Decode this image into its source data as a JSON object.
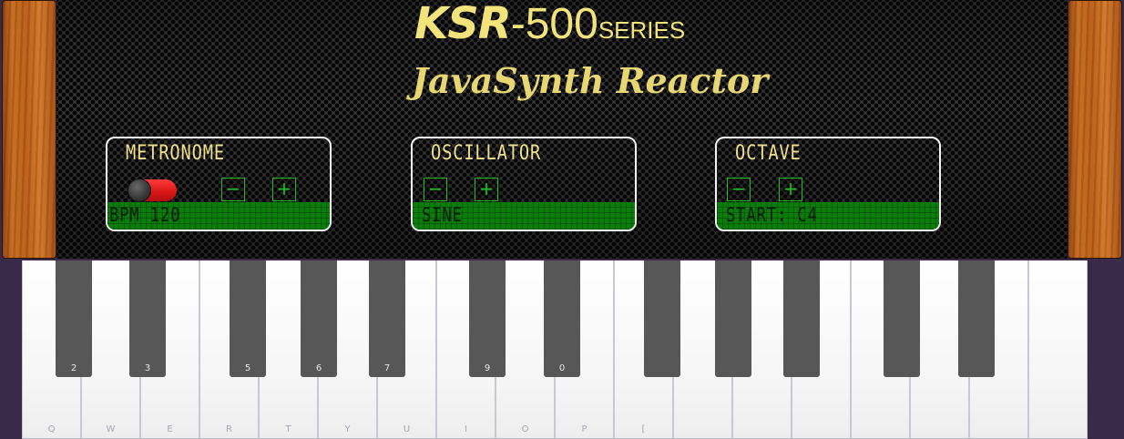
{
  "header": {
    "brand": "KSR",
    "dash": "-",
    "model": "500",
    "series": "SERIES",
    "subtitle": "JavaSynth Reactor"
  },
  "metronome": {
    "title": "METRONOME",
    "toggle_on": false,
    "minus_label": "−",
    "plus_label": "+",
    "display": "BPM 120"
  },
  "oscillator": {
    "title": "OSCILLATOR",
    "minus_label": "−",
    "plus_label": "+",
    "display": "SINE"
  },
  "octave": {
    "title": "OCTAVE",
    "minus_label": "−",
    "plus_label": "+",
    "display": "START: C4"
  },
  "keyboard": {
    "white_keys": [
      {
        "label": "Q"
      },
      {
        "label": "W"
      },
      {
        "label": "E"
      },
      {
        "label": "R"
      },
      {
        "label": "T"
      },
      {
        "label": "Y"
      },
      {
        "label": "U"
      },
      {
        "label": "I"
      },
      {
        "label": "O"
      },
      {
        "label": "P"
      },
      {
        "label": "["
      },
      {
        "label": ""
      },
      {
        "label": ""
      },
      {
        "label": ""
      },
      {
        "label": ""
      },
      {
        "label": ""
      },
      {
        "label": ""
      },
      {
        "label": ""
      }
    ],
    "black_keys": [
      {
        "label": "2"
      },
      {
        "label": "3"
      },
      {
        "label": "5"
      },
      {
        "label": "6"
      },
      {
        "label": "7"
      },
      {
        "label": "9"
      },
      {
        "label": "0"
      },
      {
        "label": ""
      },
      {
        "label": ""
      },
      {
        "label": ""
      },
      {
        "label": ""
      },
      {
        "label": ""
      }
    ]
  },
  "colors": {
    "logo": "#f3e37b",
    "lcd_green": "#0a7d0a",
    "button_green": "#20c020",
    "toggle_red": "#d81616",
    "black_key": "#575757"
  }
}
